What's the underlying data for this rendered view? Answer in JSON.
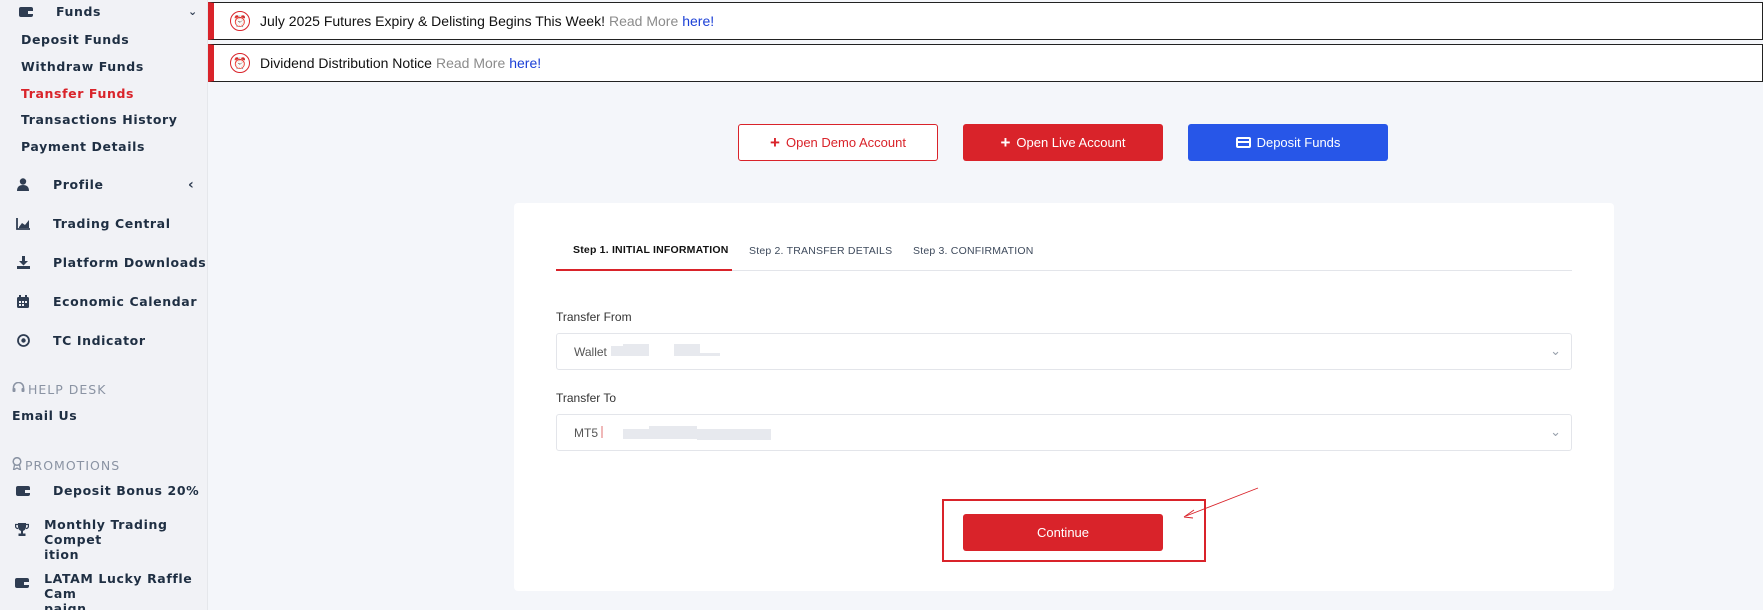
{
  "sidebar": {
    "funds": {
      "label": "Funds",
      "icon": "wallet-icon"
    },
    "funds_sub": [
      {
        "label": "Deposit Funds"
      },
      {
        "label": "Withdraw Funds"
      },
      {
        "label": "Transfer Funds",
        "active": true
      },
      {
        "label": "Transactions History"
      },
      {
        "label": "Payment Details"
      }
    ],
    "items": [
      {
        "label": "Profile",
        "icon": "user-icon"
      },
      {
        "label": "Trading Central",
        "icon": "chart-icon"
      },
      {
        "label": "Platform Downloads",
        "icon": "download-icon"
      },
      {
        "label": "Economic Calendar",
        "icon": "calendar-icon"
      },
      {
        "label": "TC Indicator",
        "icon": "target-icon"
      }
    ],
    "help_desk": {
      "header": "HELP DESK",
      "email": "Email Us"
    },
    "promotions": {
      "header": "PROMOTIONS",
      "items": [
        {
          "label": "Deposit Bonus 20%",
          "icon": "wallet-icon"
        },
        {
          "label": "Monthly Trading Compet\nition",
          "icon": "trophy-icon"
        },
        {
          "label": "LATAM Lucky Raffle Cam\npaign",
          "icon": "wallet-icon"
        }
      ]
    }
  },
  "notices": [
    {
      "text": "July 2025 Futures Expiry & Delisting Begins This Week!",
      "read_more": "Read More",
      "link": "here!"
    },
    {
      "text": "Dividend Distribution Notice",
      "read_more": "Read More",
      "link": "here!"
    }
  ],
  "actions": {
    "demo": "Open Demo Account",
    "live": "Open Live Account",
    "deposit": "Deposit Funds"
  },
  "steps": [
    {
      "label": "Step 1. INITIAL INFORMATION",
      "active": true
    },
    {
      "label": "Step 2. TRANSFER DETAILS"
    },
    {
      "label": "Step 3. CONFIRMATION"
    }
  ],
  "form": {
    "from": {
      "label": "Transfer From",
      "value": "Wallet"
    },
    "to": {
      "label": "Transfer To",
      "value": "MT5"
    },
    "continue": "Continue"
  },
  "colors": {
    "accent": "#d9232a",
    "primary_blue": "#2756e8"
  }
}
